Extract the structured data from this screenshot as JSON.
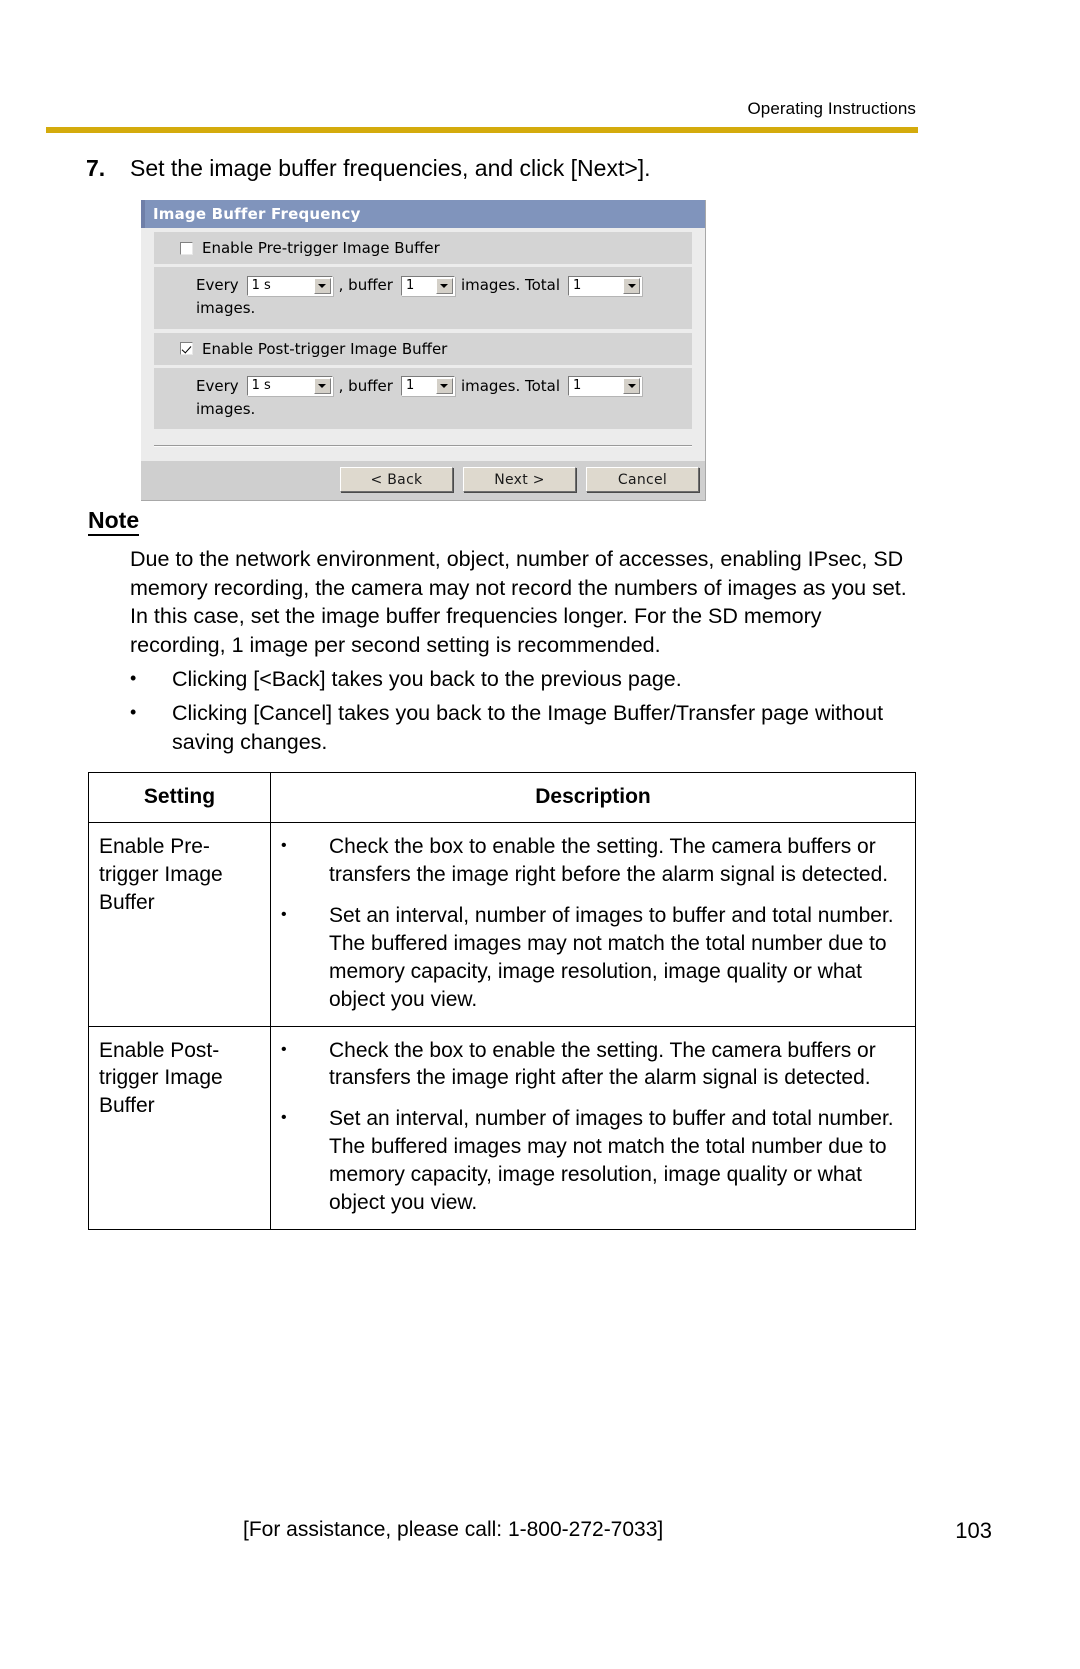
{
  "header": {
    "title": "Operating Instructions",
    "rule_color": "#d4ab0c"
  },
  "step": {
    "number": "7.",
    "text": "Set the image buffer frequencies, and click [Next>]."
  },
  "dialog": {
    "title": "Image Buffer Frequency",
    "pre_trigger": {
      "checkbox_label": "Enable Pre-trigger Image Buffer",
      "checked": false,
      "every_label": "Every",
      "interval_value": "1 s",
      "buffer_label": ", buffer",
      "buffer_value": "1",
      "images_label": "images. Total",
      "total_value": "1",
      "trailing_label": "images."
    },
    "post_trigger": {
      "checkbox_label": "Enable Post-trigger Image Buffer",
      "checked": true,
      "every_label": "Every",
      "interval_value": "1 s",
      "buffer_label": ", buffer",
      "buffer_value": "1",
      "images_label": "images. Total",
      "total_value": "1",
      "trailing_label": "images."
    },
    "buttons": {
      "back": "< Back",
      "next": "Next >",
      "cancel": "Cancel"
    },
    "titlebar_color": "#8094bc"
  },
  "note": {
    "heading": "Note",
    "paragraph": "Due to the network environment, object, number of accesses, enabling IPsec, SD memory recording, the camera may not record the numbers of images as you set. In this case, set the image buffer frequencies longer. For the SD memory recording, 1 image per second setting is recommended.",
    "bullet_glyph": "•",
    "bullets": [
      "Clicking [<Back] takes you back to the previous page.",
      "Clicking [Cancel] takes you back to the Image Buffer/Transfer page without saving changes."
    ]
  },
  "table": {
    "columns": [
      "Setting",
      "Description"
    ],
    "bullet_glyph": "•",
    "rows": [
      {
        "setting": "Enable Pre-trigger Image Buffer",
        "description": [
          "Check the box to enable the setting. The camera buffers or transfers the image right before the alarm signal is detected.",
          "Set an interval, number of images to buffer and total number. The buffered images may not match the total number due to memory capacity, image resolution, image quality or what object you view."
        ]
      },
      {
        "setting": "Enable Post-trigger Image Buffer",
        "description": [
          "Check the box to enable the setting. The camera buffers or transfers the image right after the alarm signal is detected.",
          "Set an interval, number of images to buffer and total number. The buffered images may not match the total number due to memory capacity, image resolution, image quality or what object you view."
        ]
      }
    ]
  },
  "footer": {
    "assistance": "[For assistance, please call: 1-800-272-7033]",
    "page_number": "103"
  }
}
